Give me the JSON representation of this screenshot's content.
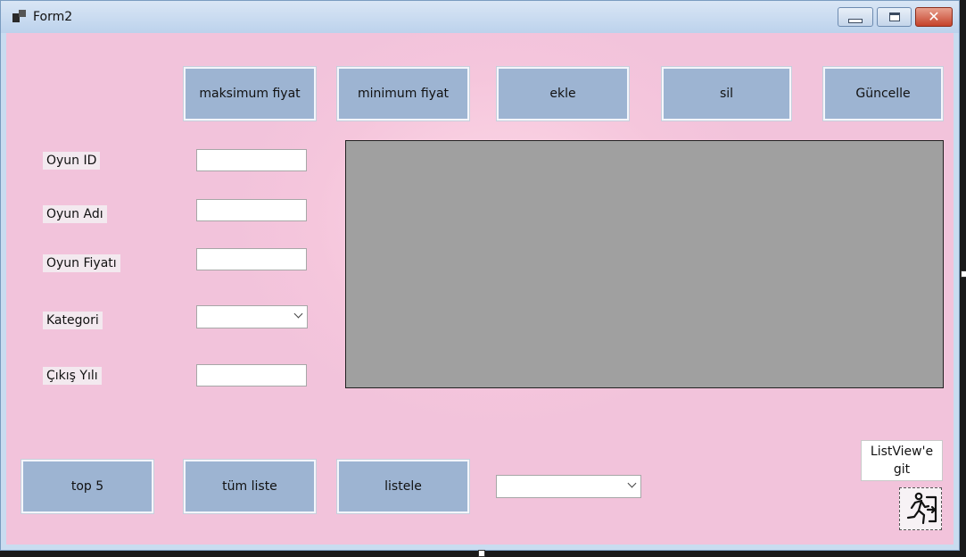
{
  "window": {
    "title": "Form2"
  },
  "top_buttons": {
    "max_price": "maksimum fiyat",
    "min_price": "minimum fiyat",
    "add": "ekle",
    "delete": "sil",
    "update": "Güncelle"
  },
  "form": {
    "game_id_label": "Oyun ID",
    "game_name_label": "Oyun Adı",
    "game_price_label": "Oyun Fiyatı",
    "category_label": "Kategori",
    "release_year_label": "Çıkış Yılı",
    "game_id_value": "",
    "game_name_value": "",
    "game_price_value": "",
    "category_value": "",
    "release_year_value": ""
  },
  "bottom_buttons": {
    "top5": "top 5",
    "all_list": "tüm liste",
    "list": "listele",
    "filter_combo_value": ""
  },
  "listview_button": {
    "line1": "ListView'e",
    "line2": "git"
  },
  "icons": {
    "app": "app-window-icon",
    "exit": "running-exit-icon"
  },
  "colors": {
    "background": "#f5c6dc",
    "button": "#9db4d2",
    "grid": "#a0a0a0",
    "close_button": "#c5432b"
  }
}
